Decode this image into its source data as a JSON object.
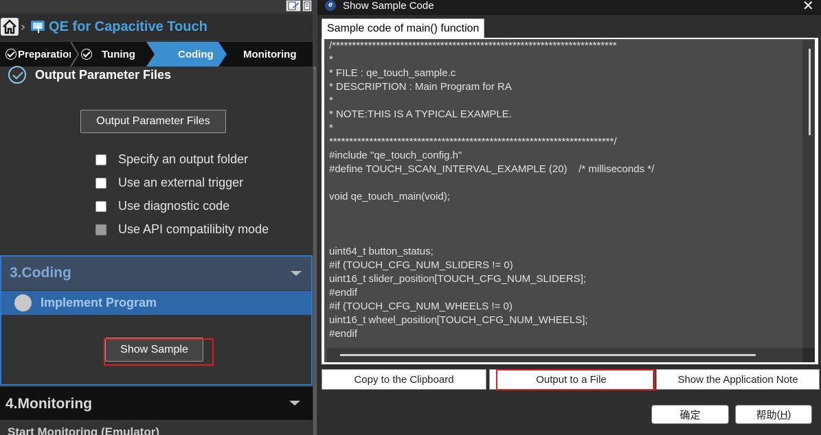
{
  "left_panel": {
    "app_title": "QE for Capacitive Touch",
    "icons": {
      "home": "home-icon",
      "app": "qe-touch-icon",
      "breadcrumb": "chevron-right-icon",
      "toolbar_1": "edit-icon",
      "toolbar_2": "document-icon"
    },
    "steps": [
      {
        "label": "Preparation",
        "state": "done"
      },
      {
        "label": "Tuning",
        "state": "done"
      },
      {
        "label": "Coding",
        "state": "active"
      },
      {
        "label": "Monitoring",
        "state": "pending"
      }
    ],
    "output_section": {
      "header": "Output Parameter Files",
      "button": "Output Parameter Files",
      "options": [
        {
          "label": "Specify an output folder",
          "checked": false,
          "enabled": true
        },
        {
          "label": "Use an external trigger",
          "checked": false,
          "enabled": true
        },
        {
          "label": "Use diagnostic code",
          "checked": false,
          "enabled": true
        },
        {
          "label": "Use API compatilibity mode",
          "checked": false,
          "enabled": false
        }
      ]
    },
    "coding_section": {
      "title": "3.Coding",
      "item": "Implement Program",
      "button": "Show Sample"
    },
    "monitoring_section": {
      "title": "4.Monitoring",
      "item": "Start Monitoring (Emulator)"
    }
  },
  "dialog": {
    "title": "Show Sample Code",
    "tab": "Sample code of main() function",
    "code_lines": [
      "/***********************************************************************",
      "*",
      "* FILE : qe_touch_sample.c",
      "* DESCRIPTION : Main Program for RA",
      "*",
      "* NOTE:THIS IS A TYPICAL EXAMPLE.",
      "*",
      "***********************************************************************/",
      "#include \"qe_touch_config.h\"",
      "#define TOUCH_SCAN_INTERVAL_EXAMPLE (20)    /* milliseconds */",
      "",
      "void qe_touch_main(void);",
      "",
      "",
      "",
      "uint64_t button_status;",
      "#if (TOUCH_CFG_NUM_SLIDERS != 0)",
      "uint16_t slider_position[TOUCH_CFG_NUM_SLIDERS];",
      "#endif",
      "#if (TOUCH_CFG_NUM_WHEELS != 0)",
      "uint16_t wheel_position[TOUCH_CFG_NUM_WHEELS];",
      "#endif"
    ],
    "buttons": {
      "copy": "Copy to the Clipboard",
      "output_file": "Output to a File",
      "app_note": "Show the Application Note",
      "ok": "确定",
      "help": "帮助",
      "help_key": "H"
    }
  },
  "colors": {
    "accent": "#3a8fd0",
    "title_blue": "#4aa3df",
    "highlight_red": "#e02020",
    "coding_border": "#2f79c6"
  }
}
